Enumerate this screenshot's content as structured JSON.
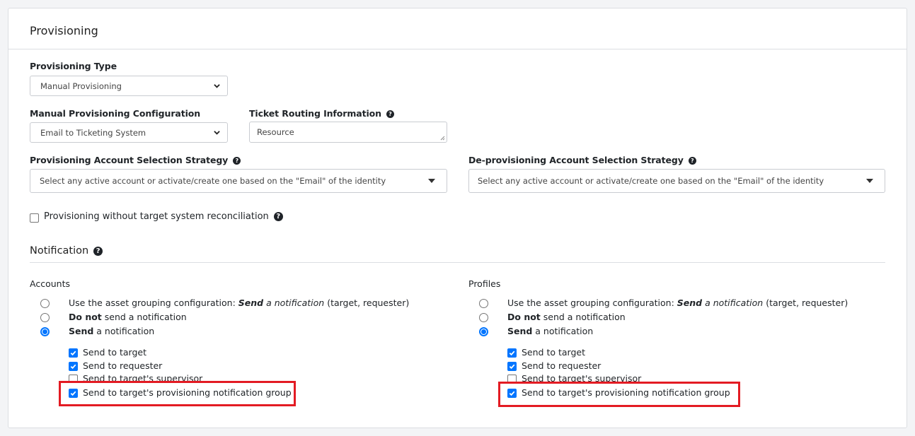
{
  "panel": {
    "title": "Provisioning"
  },
  "provisioning_type": {
    "label": "Provisioning Type",
    "value": "Manual Provisioning"
  },
  "manual_config": {
    "label": "Manual Provisioning Configuration",
    "value": "Email to Ticketing System"
  },
  "ticket_routing": {
    "label": "Ticket Routing Information",
    "value": "Resource"
  },
  "prov_strategy": {
    "label": "Provisioning Account Selection Strategy",
    "value": "Select any active account or activate/create one based on the \"Email\" of the identity"
  },
  "deprov_strategy": {
    "label": "De-provisioning Account Selection Strategy",
    "value": "Select any active account or activate/create one based on the \"Email\" of the identity"
  },
  "no_reconciliation": {
    "label": "Provisioning without target system reconciliation",
    "checked": false
  },
  "notification": {
    "title": "Notification",
    "accounts": {
      "title": "Accounts",
      "radios": [
        {
          "prefix": "Use the asset grouping configuration: ",
          "em_bold": "Send",
          "em": " a notification",
          "suffix": " (target, requester)",
          "selected": false
        },
        {
          "bold": "Do not",
          "rest": " send a notification",
          "selected": false
        },
        {
          "bold": "Send",
          "rest": " a notification",
          "selected": true
        }
      ],
      "checks": [
        {
          "label": "Send to target",
          "checked": true
        },
        {
          "label": "Send to requester",
          "checked": true
        },
        {
          "label": "Send to target's supervisor",
          "checked": false
        },
        {
          "label": "Send to target's provisioning notification group",
          "checked": true
        }
      ]
    },
    "profiles": {
      "title": "Profiles",
      "radios": [
        {
          "prefix": "Use the asset grouping configuration: ",
          "em_bold": "Send",
          "em": " a notification",
          "suffix": " (target, requester)",
          "selected": false
        },
        {
          "bold": "Do not",
          "rest": " send a notification",
          "selected": false
        },
        {
          "bold": "Send",
          "rest": " a notification",
          "selected": true
        }
      ],
      "checks": [
        {
          "label": "Send to target",
          "checked": true
        },
        {
          "label": "Send to requester",
          "checked": true
        },
        {
          "label": "Send to target's supervisor",
          "checked": false
        },
        {
          "label": "Send to target's provisioning notification group",
          "checked": true
        }
      ]
    }
  },
  "colors": {
    "accent": "#0075ff",
    "highlight": "#e31b23"
  }
}
